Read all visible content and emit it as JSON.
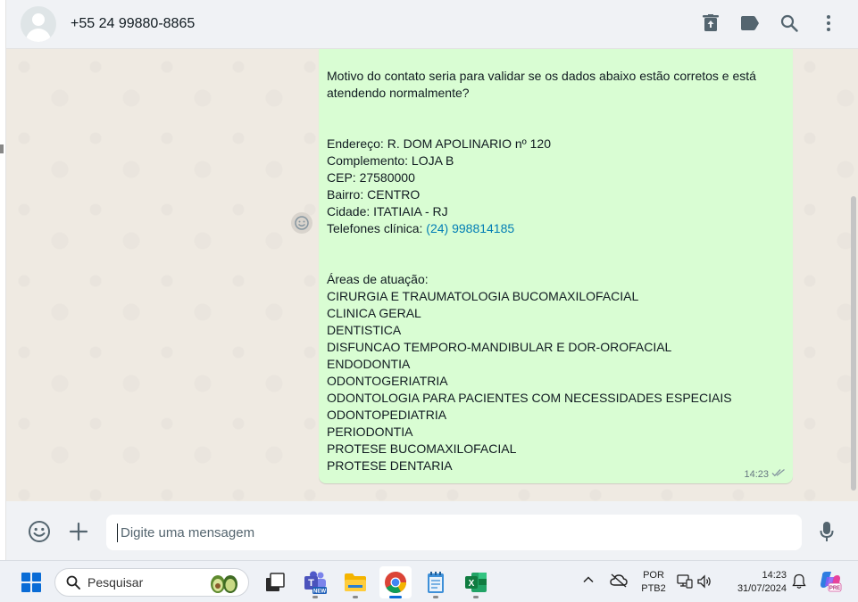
{
  "header": {
    "contact_name": "+55 24 99880-8865",
    "icons": [
      "archive-icon",
      "label-icon",
      "search-icon",
      "menu-icon"
    ]
  },
  "message": {
    "intro": "Motivo do contato seria para validar se os dados abaixo estão corretos e está atendendo normalmente?",
    "address_lines": [
      "Endereço: R. DOM APOLINARIO nº 120",
      "Complemento: LOJA B",
      "CEP: 27580000",
      "Bairro: CENTRO",
      "Cidade: ITATIAIA - RJ"
    ],
    "phone_label": "Telefones clínica: ",
    "phone_value": "(24) 998814185",
    "areas_title": "Áreas de atuação:",
    "areas": [
      "CIRURGIA E TRAUMATOLOGIA BUCOMAXILOFACIAL",
      "CLINICA GERAL",
      "DENTISTICA",
      "DISFUNCAO TEMPORO-MANDIBULAR E DOR-OROFACIAL",
      "ENDODONTIA",
      "ODONTOGERIATRIA",
      "ODONTOLOGIA PARA PACIENTES COM NECESSIDADES ESPECIAIS",
      "ODONTOPEDIATRIA",
      "PERIODONTIA",
      "PROTESE BUCOMAXILOFACIAL",
      "PROTESE DENTARIA"
    ],
    "time": "14:23",
    "status": "delivered"
  },
  "composer": {
    "placeholder": "Digite uma mensagem"
  },
  "taskbar": {
    "search_label": "Pesquisar",
    "apps": [
      "task-view",
      "teams",
      "file-explorer",
      "chrome",
      "notepad",
      "excel"
    ],
    "active_app": "chrome",
    "lang_line1": "POR",
    "lang_line2": "PTB2",
    "time": "14:23",
    "date": "31/07/2024"
  },
  "colors": {
    "bubble": "#d9fdd3",
    "chat_bg": "#efeae2",
    "link": "#027eb5",
    "accent": "#0a6cd6"
  }
}
